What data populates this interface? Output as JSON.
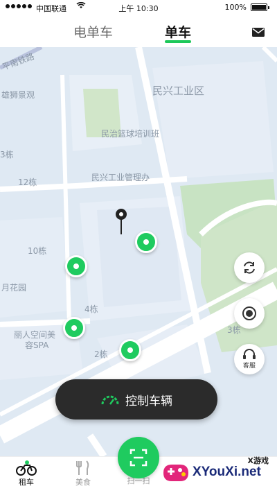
{
  "status_bar": {
    "carrier": "中国联通",
    "time": "上午 10:30",
    "battery": "100%"
  },
  "header": {
    "tabs": [
      "电单车",
      "单车"
    ],
    "active_tab": "单车",
    "mail_icon": "mail-icon"
  },
  "map": {
    "labels": {
      "road": "平南铁路",
      "xiongshi": "雄狮景观",
      "minxing_industrial": "民兴工业区",
      "basketball": "民治篮球培训班",
      "management_office": "民兴工业管理办",
      "bldg_3_left": "3栋",
      "bldg_12": "12栋",
      "bldg_10": "10栋",
      "yuehua": "月花园",
      "bldg_4": "4栋",
      "spa_line1": "丽人空间美",
      "spa_line2": "容SPA",
      "bldg_2": "2栋",
      "bldg_3_right": "3栋"
    }
  },
  "side_buttons": {
    "refresh_icon": "refresh-icon",
    "locate_icon": "locate-icon",
    "service_label": "客服"
  },
  "control_button": {
    "label": "控制车辆"
  },
  "bottom_nav": {
    "rent": "租车",
    "food": "美食",
    "scan": "扫一扫"
  },
  "watermark": {
    "top": "X游戏",
    "main": "XYouXi.net"
  },
  "colors": {
    "accent": "#1fcb5f",
    "dark_button": "#2b2b2b",
    "map_bg": "#dfe9f3"
  }
}
